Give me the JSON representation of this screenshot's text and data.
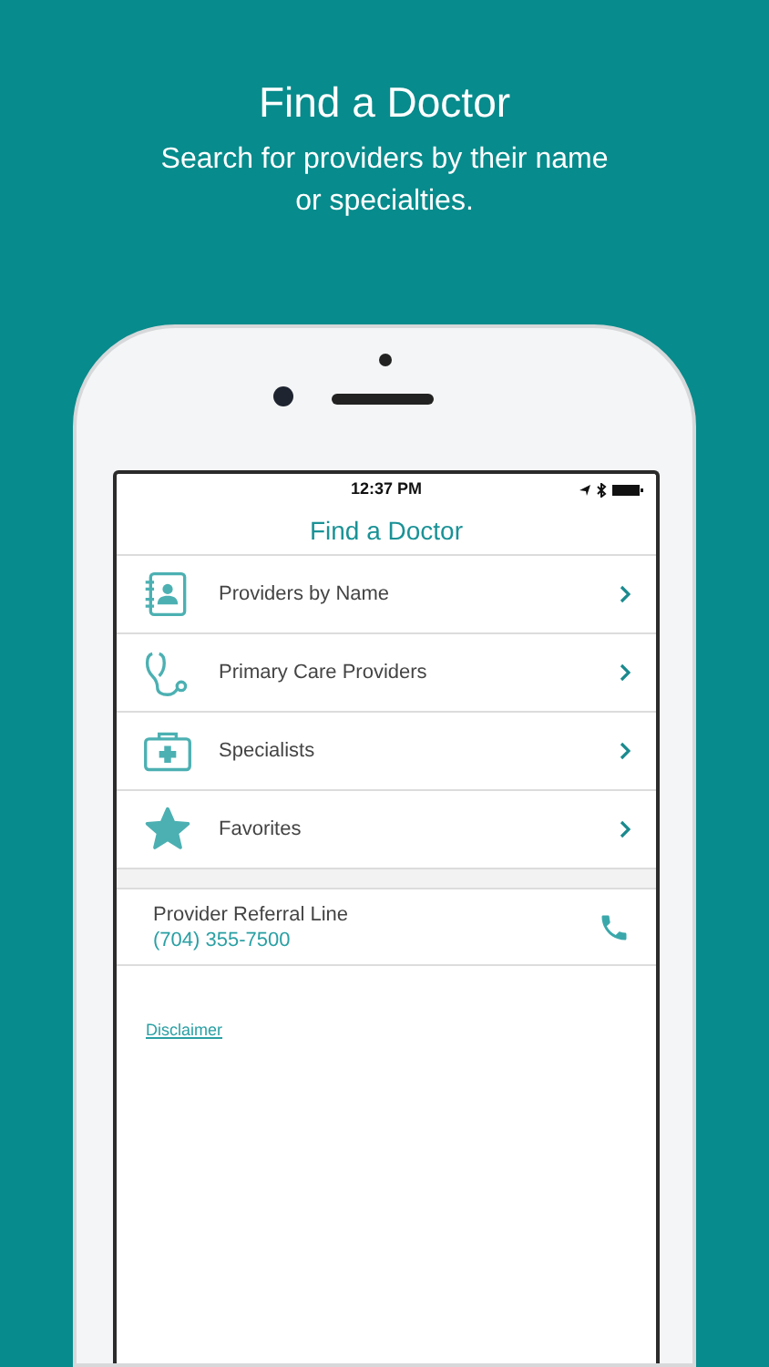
{
  "header": {
    "title": "Find a Doctor",
    "subtitle": "Search for providers by their name or specialties."
  },
  "status_bar": {
    "time": "12:37 PM"
  },
  "nav": {
    "title": "Find a Doctor"
  },
  "menu": [
    {
      "label": "Providers by Name"
    },
    {
      "label": "Primary Care Providers"
    },
    {
      "label": "Specialists"
    },
    {
      "label": "Favorites"
    }
  ],
  "referral": {
    "label": "Provider Referral Line",
    "phone": "(704) 355-7500"
  },
  "disclaimer": "Disclaimer"
}
